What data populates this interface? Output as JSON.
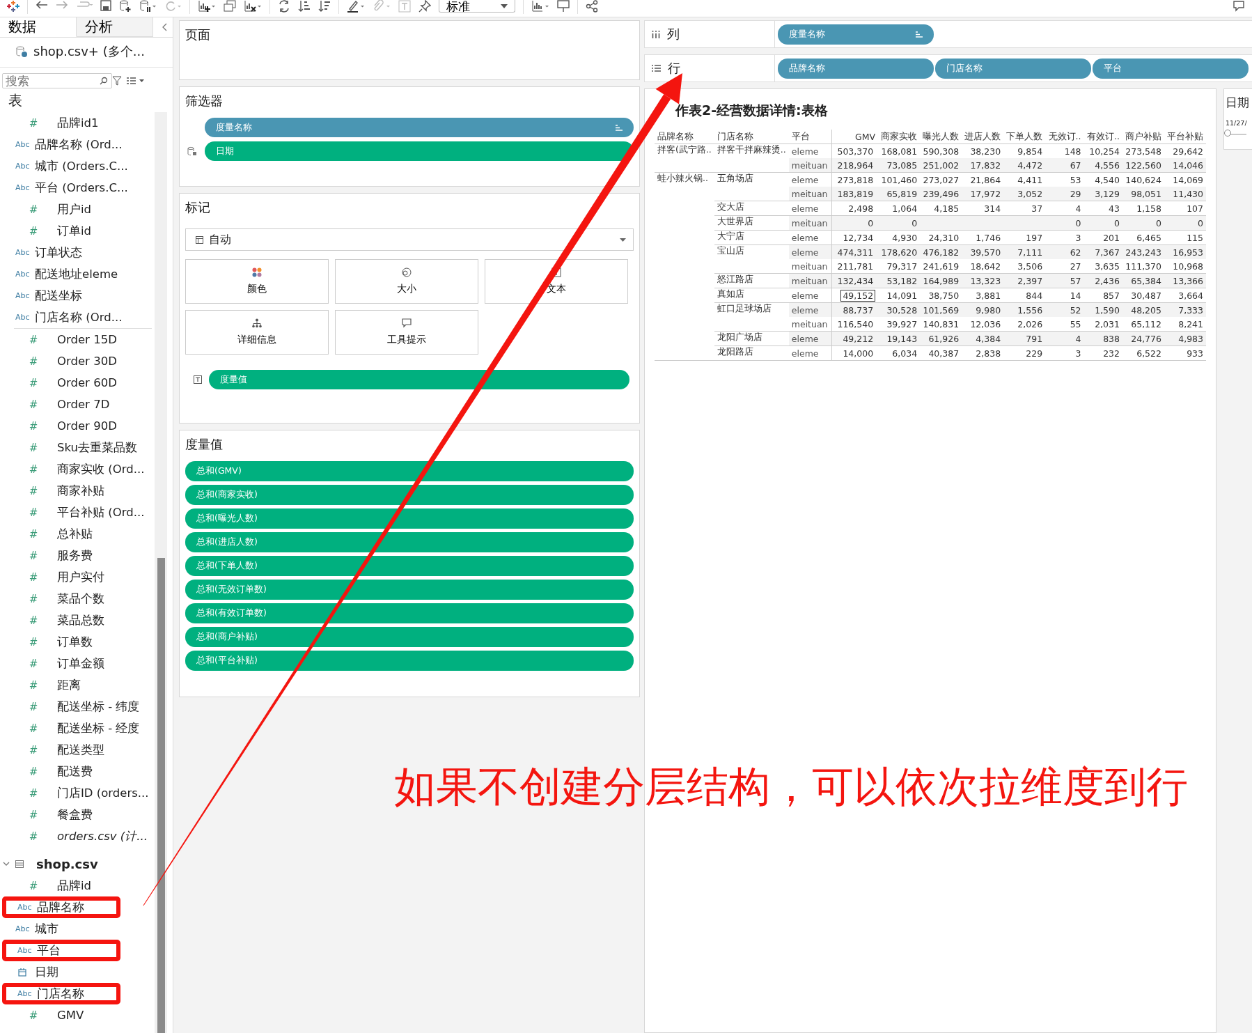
{
  "toolbar": {
    "fit_dropdown": "标准"
  },
  "data_pane": {
    "tabs": [
      {
        "label": "数据",
        "selected": true
      },
      {
        "label": "分析",
        "selected": false
      }
    ],
    "data_source": "shop.csv+ (多个...",
    "search": {
      "placeholder": "搜索"
    },
    "section_title": "表",
    "orders_dimensions": [
      {
        "name": "品牌id1",
        "kind": "number",
        "icon": "#"
      },
      {
        "name": "品牌名称 (Ord...",
        "kind": "text",
        "icon": "Abc"
      },
      {
        "name": "城市 (Orders.C...",
        "kind": "text",
        "icon": "Abc"
      },
      {
        "name": "平台 (Orders.C...",
        "kind": "text",
        "icon": "Abc"
      },
      {
        "name": "用户id",
        "kind": "number",
        "icon": "#"
      },
      {
        "name": "订单id",
        "kind": "number",
        "icon": "#"
      },
      {
        "name": "订单状态",
        "kind": "text",
        "icon": "Abc"
      },
      {
        "name": "配送地址eleme",
        "kind": "text",
        "icon": "Abc"
      },
      {
        "name": "配送坐标",
        "kind": "text",
        "icon": "Abc"
      },
      {
        "name": "门店名称 (Ord...",
        "kind": "text",
        "icon": "Abc"
      }
    ],
    "orders_measures": [
      {
        "name": "Order 15D",
        "kind": "number",
        "icon": "#"
      },
      {
        "name": "Order 30D",
        "kind": "number",
        "icon": "#"
      },
      {
        "name": "Order 60D",
        "kind": "number",
        "icon": "#"
      },
      {
        "name": "Order 7D",
        "kind": "number",
        "icon": "#"
      },
      {
        "name": "Order 90D",
        "kind": "number",
        "icon": "#"
      },
      {
        "name": "Sku去重菜品数",
        "kind": "number",
        "icon": "#"
      },
      {
        "name": "商家实收 (Ord...",
        "kind": "number",
        "icon": "#"
      },
      {
        "name": "商家补贴",
        "kind": "number",
        "icon": "#"
      },
      {
        "name": "平台补贴 (Ord...",
        "kind": "number",
        "icon": "#"
      },
      {
        "name": "总补贴",
        "kind": "number",
        "icon": "#"
      },
      {
        "name": "服务费",
        "kind": "number",
        "icon": "#"
      },
      {
        "name": "用户实付",
        "kind": "number",
        "icon": "#"
      },
      {
        "name": "菜品个数",
        "kind": "number",
        "icon": "#"
      },
      {
        "name": "菜品总数",
        "kind": "number",
        "icon": "#"
      },
      {
        "name": "订单数",
        "kind": "number",
        "icon": "#"
      },
      {
        "name": "订单金额",
        "kind": "number",
        "icon": "#"
      },
      {
        "name": "距离",
        "kind": "number",
        "icon": "#"
      },
      {
        "name": "配送坐标 - 纬度",
        "kind": "number",
        "icon": "#"
      },
      {
        "name": "配送坐标 - 经度",
        "kind": "number",
        "icon": "#"
      },
      {
        "name": "配送类型",
        "kind": "number",
        "icon": "#"
      },
      {
        "name": "配送费",
        "kind": "number",
        "icon": "#"
      },
      {
        "name": "门店ID (orders...",
        "kind": "number",
        "icon": "#"
      },
      {
        "name": "餐盒费",
        "kind": "number",
        "icon": "#"
      },
      {
        "name": "orders.csv (计...",
        "kind": "calculation",
        "icon": "#"
      }
    ],
    "shop_table": {
      "name": "shop.csv",
      "expanded": true,
      "fields": [
        {
          "name": "品牌id",
          "kind": "number",
          "icon": "#",
          "highlighted": false
        },
        {
          "name": "品牌名称",
          "kind": "text",
          "icon": "Abc",
          "highlighted": true
        },
        {
          "name": "城市",
          "kind": "text",
          "icon": "Abc",
          "highlighted": false
        },
        {
          "name": "平台",
          "kind": "text",
          "icon": "Abc",
          "highlighted": true
        },
        {
          "name": "日期",
          "kind": "date",
          "highlighted": false
        },
        {
          "name": "门店名称",
          "kind": "text",
          "icon": "Abc",
          "highlighted": true
        },
        {
          "name": "GMV",
          "kind": "number",
          "icon": "#",
          "highlighted": false
        }
      ]
    }
  },
  "pages_card": {
    "title": "页面"
  },
  "filters_card": {
    "title": "筛选器",
    "pills": [
      {
        "label": "度量名称",
        "kind": "dimension",
        "sorted": true
      },
      {
        "label": "日期",
        "kind": "measure",
        "sorted": false
      }
    ]
  },
  "marks_card": {
    "title": "标记",
    "mark_type": "自动",
    "buttons": [
      {
        "label": "颜色",
        "kind": "color"
      },
      {
        "label": "大小",
        "kind": "size"
      },
      {
        "label": "文本",
        "kind": "text"
      },
      {
        "label": "详细信息",
        "kind": "detail"
      },
      {
        "label": "工具提示",
        "kind": "tooltip"
      }
    ],
    "text_pill": {
      "label": "度量值",
      "kind": "measure"
    }
  },
  "measure_values_card": {
    "title": "度量值",
    "pills": [
      {
        "label": "总和(GMV)",
        "kind": "measure"
      },
      {
        "label": "总和(商家实收)",
        "kind": "measure"
      },
      {
        "label": "总和(曝光人数)",
        "kind": "measure"
      },
      {
        "label": "总和(进店人数)",
        "kind": "measure"
      },
      {
        "label": "总和(下单人数)",
        "kind": "measure"
      },
      {
        "label": "总和(无效订单数)",
        "kind": "measure"
      },
      {
        "label": "总和(有效订单数)",
        "kind": "measure"
      },
      {
        "label": "总和(商户补贴)",
        "kind": "measure"
      },
      {
        "label": "总和(平台补贴)",
        "kind": "measure"
      }
    ]
  },
  "columns_shelf": {
    "label": "列",
    "pills": [
      {
        "label": "度量名称",
        "kind": "dimension",
        "sorted": true
      }
    ]
  },
  "rows_shelf": {
    "label": "行",
    "pills": [
      {
        "label": "品牌名称",
        "kind": "dimension",
        "sorted": false
      },
      {
        "label": "门店名称",
        "kind": "dimension",
        "sorted": false
      },
      {
        "label": "平台",
        "kind": "dimension",
        "sorted": false
      }
    ]
  },
  "view": {
    "title": "作表2-经营数据详情:表格",
    "table": {
      "columns": [
        "品牌名称",
        "门店名称",
        "平台",
        "GMV",
        "商家实收",
        "曝光人数",
        "进店人数",
        "下单人数",
        "无效订..",
        "有效订..",
        "商户补贴",
        "平台补贴"
      ],
      "groups": [
        {
          "brand": "拌客(武宁路..",
          "stores": [
            {
              "store": "拌客干拌麻辣烫..",
              "rows": [
                {
                  "platform": "eleme",
                  "selected": false,
                  "values": [
                    "503,370",
                    "168,081",
                    "590,308",
                    "38,230",
                    "9,854",
                    "148",
                    "10,254",
                    "273,548",
                    "29,642"
                  ]
                },
                {
                  "platform": "meituan",
                  "selected": false,
                  "values": [
                    "218,964",
                    "73,085",
                    "251,002",
                    "17,832",
                    "4,472",
                    "67",
                    "4,556",
                    "122,560",
                    "14,046"
                  ]
                }
              ]
            }
          ]
        },
        {
          "brand": "蛙小辣火锅..",
          "stores": [
            {
              "store": "五角场店",
              "rows": [
                {
                  "platform": "eleme",
                  "selected": false,
                  "values": [
                    "273,818",
                    "101,460",
                    "273,027",
                    "21,864",
                    "4,411",
                    "53",
                    "4,540",
                    "140,624",
                    "14,069"
                  ]
                },
                {
                  "platform": "meituan",
                  "selected": false,
                  "values": [
                    "183,819",
                    "65,819",
                    "239,496",
                    "17,972",
                    "3,052",
                    "29",
                    "3,129",
                    "98,051",
                    "11,430"
                  ]
                }
              ]
            },
            {
              "store": "交大店",
              "rows": [
                {
                  "platform": "eleme",
                  "selected": false,
                  "values": [
                    "2,498",
                    "1,064",
                    "4,185",
                    "314",
                    "37",
                    "4",
                    "43",
                    "1,158",
                    "107"
                  ]
                }
              ]
            },
            {
              "store": "大世界店",
              "rows": [
                {
                  "platform": "meituan",
                  "selected": false,
                  "values": [
                    "0",
                    "0"
                  ],
                  "values_after_gap": [
                    "0",
                    "0",
                    "0",
                    "0"
                  ]
                }
              ]
            },
            {
              "store": "大宁店",
              "rows": [
                {
                  "platform": "eleme",
                  "selected": false,
                  "values": [
                    "12,734",
                    "4,930",
                    "24,310",
                    "1,746",
                    "197",
                    "3",
                    "201",
                    "6,465",
                    "115"
                  ]
                }
              ]
            },
            {
              "store": "宝山店",
              "rows": [
                {
                  "platform": "eleme",
                  "selected": false,
                  "values": [
                    "474,311",
                    "178,620",
                    "476,182",
                    "39,570",
                    "7,111",
                    "62",
                    "7,367",
                    "243,243",
                    "16,953"
                  ]
                },
                {
                  "platform": "meituan",
                  "selected": false,
                  "values": [
                    "211,781",
                    "79,317",
                    "241,619",
                    "18,642",
                    "3,506",
                    "27",
                    "3,635",
                    "111,370",
                    "10,968"
                  ]
                }
              ]
            },
            {
              "store": "怒江路店",
              "rows": [
                {
                  "platform": "meituan",
                  "selected": false,
                  "values": [
                    "132,434",
                    "53,182",
                    "164,989",
                    "13,323",
                    "2,397",
                    "57",
                    "2,436",
                    "65,384",
                    "13,366"
                  ]
                }
              ]
            },
            {
              "store": "真如店",
              "rows": [
                {
                  "platform": "eleme",
                  "selected": true,
                  "values": [
                    "49,152",
                    "14,091",
                    "38,750",
                    "3,881",
                    "844",
                    "14",
                    "857",
                    "30,487",
                    "3,664"
                  ]
                }
              ]
            },
            {
              "store": "虹口足球场店",
              "rows": [
                {
                  "platform": "eleme",
                  "selected": false,
                  "values": [
                    "88,737",
                    "30,528",
                    "101,569",
                    "9,980",
                    "1,556",
                    "52",
                    "1,590",
                    "48,205",
                    "7,333"
                  ]
                },
                {
                  "platform": "meituan",
                  "selected": false,
                  "values": [
                    "116,540",
                    "39,927",
                    "140,831",
                    "12,036",
                    "2,026",
                    "55",
                    "2,031",
                    "65,112",
                    "8,241"
                  ]
                }
              ]
            },
            {
              "store": "龙阳广场店",
              "rows": [
                {
                  "platform": "eleme",
                  "selected": false,
                  "values": [
                    "49,212",
                    "19,143",
                    "61,926",
                    "4,384",
                    "791",
                    "4",
                    "838",
                    "24,776",
                    "4,983"
                  ]
                }
              ]
            },
            {
              "store": "龙阳路店",
              "rows": [
                {
                  "platform": "eleme",
                  "selected": false,
                  "values": [
                    "14,000",
                    "6,034",
                    "40,387",
                    "2,838",
                    "229",
                    "3",
                    "232",
                    "6,522",
                    "933"
                  ]
                }
              ]
            }
          ]
        }
      ]
    }
  },
  "date_filter_card": {
    "title": "日期",
    "range_start": "11/27/",
    "level": 0
  },
  "annotation": {
    "text": "如果不创建分层结构，可以依次拉维度到行"
  }
}
